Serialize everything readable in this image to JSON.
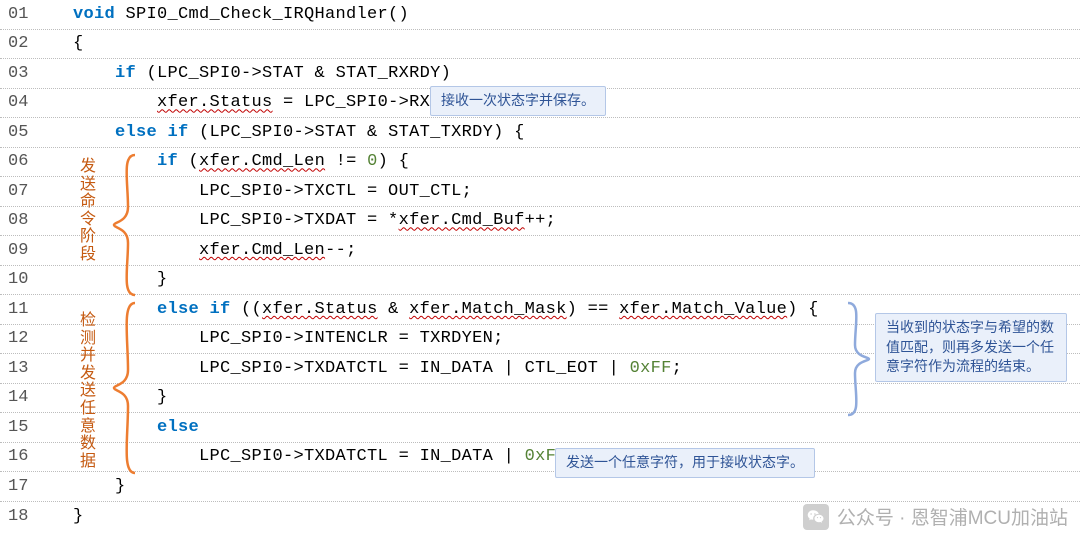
{
  "lines": [
    {
      "n": "01",
      "indent": 0,
      "tokens": [
        [
          "kw",
          "void"
        ],
        [
          "plain",
          " SPI0_Cmd_Check_IRQHandler()"
        ]
      ]
    },
    {
      "n": "02",
      "indent": 0,
      "tokens": [
        [
          "plain",
          "{"
        ]
      ]
    },
    {
      "n": "03",
      "indent": 1,
      "tokens": [
        [
          "kw",
          "if"
        ],
        [
          "plain",
          " (LPC_SPI0->STAT & STAT_RXRDY)"
        ]
      ]
    },
    {
      "n": "04",
      "indent": 2,
      "tokens": [
        [
          "wavy",
          "xfer.Status"
        ],
        [
          "plain",
          " = LPC_SPI0->RXDAT;"
        ]
      ]
    },
    {
      "n": "05",
      "indent": 1,
      "tokens": [
        [
          "kw",
          "else if"
        ],
        [
          "plain",
          " (LPC_SPI0->STAT & STAT_TXRDY) {"
        ]
      ]
    },
    {
      "n": "06",
      "indent": 2,
      "tokens": [
        [
          "kw",
          "if"
        ],
        [
          "plain",
          " ("
        ],
        [
          "wavy",
          "xfer.Cmd_Len"
        ],
        [
          "plain",
          " != "
        ],
        [
          "num",
          "0"
        ],
        [
          "plain",
          ") {"
        ]
      ]
    },
    {
      "n": "07",
      "indent": 3,
      "tokens": [
        [
          "plain",
          "LPC_SPI0->TXCTL = OUT_CTL;"
        ]
      ]
    },
    {
      "n": "08",
      "indent": 3,
      "tokens": [
        [
          "plain",
          "LPC_SPI0->TXDAT = *"
        ],
        [
          "wavy",
          "xfer.Cmd_Buf"
        ],
        [
          "plain",
          "++;"
        ]
      ]
    },
    {
      "n": "09",
      "indent": 3,
      "tokens": [
        [
          "wavy",
          "xfer.Cmd_Len"
        ],
        [
          "plain",
          "--;"
        ]
      ]
    },
    {
      "n": "10",
      "indent": 2,
      "tokens": [
        [
          "plain",
          "}"
        ]
      ]
    },
    {
      "n": "11",
      "indent": 2,
      "tokens": [
        [
          "kw",
          "else if"
        ],
        [
          "plain",
          " (("
        ],
        [
          "wavy",
          "xfer.Status"
        ],
        [
          "plain",
          " & "
        ],
        [
          "wavy",
          "xfer.Match_Mask"
        ],
        [
          "plain",
          ") == "
        ],
        [
          "wavy",
          "xfer.Match_Value"
        ],
        [
          "plain",
          ") {"
        ]
      ]
    },
    {
      "n": "12",
      "indent": 3,
      "tokens": [
        [
          "plain",
          "LPC_SPI0->INTENCLR = TXRDYEN;"
        ]
      ]
    },
    {
      "n": "13",
      "indent": 3,
      "tokens": [
        [
          "plain",
          "LPC_SPI0->TXDATCTL = IN_DATA | CTL_EOT | "
        ],
        [
          "num",
          "0xFF"
        ],
        [
          "plain",
          ";"
        ]
      ]
    },
    {
      "n": "14",
      "indent": 2,
      "tokens": [
        [
          "plain",
          "}"
        ]
      ]
    },
    {
      "n": "15",
      "indent": 2,
      "tokens": [
        [
          "kw",
          "else"
        ]
      ]
    },
    {
      "n": "16",
      "indent": 3,
      "tokens": [
        [
          "plain",
          "LPC_SPI0->TXDATCTL = IN_DATA | "
        ],
        [
          "num",
          "0xFF"
        ],
        [
          "plain",
          ";"
        ]
      ]
    },
    {
      "n": "17",
      "indent": 1,
      "tokens": [
        [
          "plain",
          "}"
        ]
      ]
    },
    {
      "n": "18",
      "indent": 0,
      "tokens": [
        [
          "plain",
          "}"
        ]
      ]
    }
  ],
  "callouts": {
    "c1": "接收一次状态字并保存。",
    "c2": "当收到的状态字与希望的数值匹配，则再多发送一个任意字符作为流程的结束。",
    "c3": "发送一个任意字符，用于接收状态字。"
  },
  "vlabels": {
    "v1": "发送命令阶段",
    "v2": "检测并发送任意数据"
  },
  "watermark": {
    "prefix": "公众号 · ",
    "name": "恩智浦MCU加油站"
  }
}
